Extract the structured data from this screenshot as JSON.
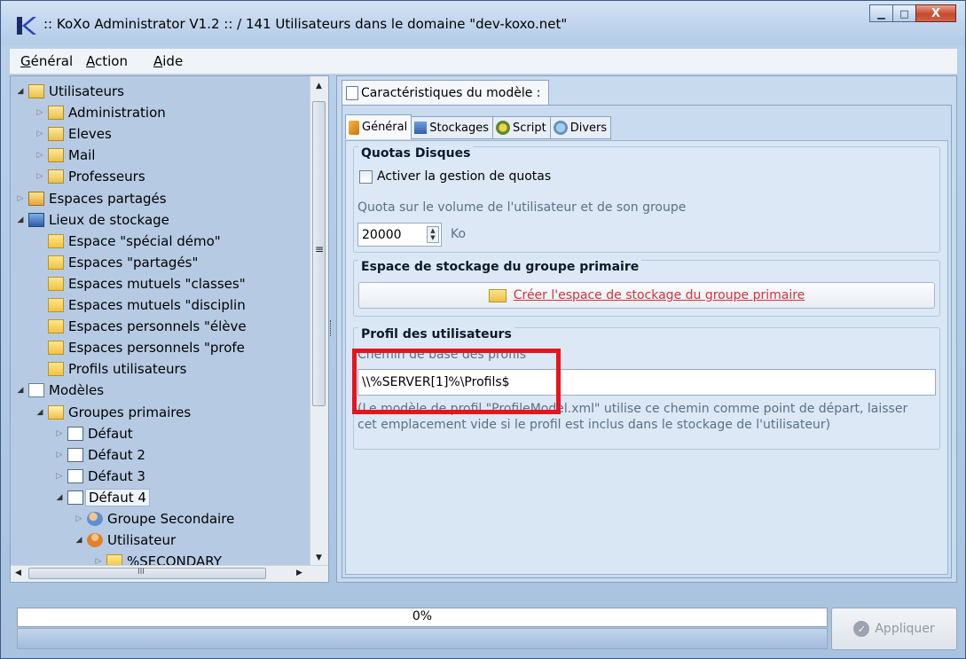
{
  "window": {
    "title": ":: KoXo Administrator V1.2 :: / 141 Utilisateurs dans le domaine \"dev-koxo.net\"",
    "minimize_glyph": "▁",
    "maximize_glyph": "□",
    "close_glyph": "X"
  },
  "menu": {
    "items": [
      "Général",
      "Action",
      "Aide"
    ]
  },
  "tree": {
    "items": [
      {
        "label": "Utilisateurs",
        "level": 0,
        "icon": "folder-users-icon",
        "state": "open"
      },
      {
        "label": "Administration",
        "level": 1,
        "icon": "folder-group-icon",
        "state": "closed"
      },
      {
        "label": "Eleves",
        "level": 1,
        "icon": "folder-group-icon",
        "state": "closed"
      },
      {
        "label": "Mail",
        "level": 1,
        "icon": "folder-group-icon",
        "state": "closed"
      },
      {
        "label": "Professeurs",
        "level": 1,
        "icon": "folder-group-icon",
        "state": "closed"
      },
      {
        "label": "Espaces partagés",
        "level": 0,
        "icon": "shared-spaces-icon",
        "state": "closed"
      },
      {
        "label": "Lieux de stockage",
        "level": 0,
        "icon": "storage-icon",
        "state": "open"
      },
      {
        "label": "Espace \"spécial démo\"",
        "level": 1,
        "icon": "folder-icon",
        "state": "leaf"
      },
      {
        "label": "Espaces \"partagés\"",
        "level": 1,
        "icon": "folder-icon",
        "state": "leaf"
      },
      {
        "label": "Espaces mutuels \"classes\"",
        "level": 1,
        "icon": "folder-icon",
        "state": "leaf"
      },
      {
        "label": "Espaces mutuels \"disciplin",
        "level": 1,
        "icon": "folder-icon",
        "state": "leaf"
      },
      {
        "label": "Espaces personnels \"élève",
        "level": 1,
        "icon": "folder-icon",
        "state": "leaf"
      },
      {
        "label": "Espaces personnels \"profe",
        "level": 1,
        "icon": "folder-icon",
        "state": "leaf"
      },
      {
        "label": "Profils utilisateurs",
        "level": 1,
        "icon": "folder-icon",
        "state": "leaf"
      },
      {
        "label": "Modèles",
        "level": 0,
        "icon": "models-icon",
        "state": "open"
      },
      {
        "label": "Groupes primaires",
        "level": 1,
        "icon": "folder-open-icon",
        "state": "open"
      },
      {
        "label": "Défaut",
        "level": 2,
        "icon": "model-doc-icon",
        "state": "closed"
      },
      {
        "label": "Défaut 2",
        "level": 2,
        "icon": "model-doc-icon",
        "state": "closed"
      },
      {
        "label": "Défaut 3",
        "level": 2,
        "icon": "model-doc-icon",
        "state": "closed"
      },
      {
        "label": "Défaut 4",
        "level": 2,
        "icon": "model-doc-icon",
        "state": "open",
        "selected": true
      },
      {
        "label": "Groupe Secondaire",
        "level": 3,
        "icon": "group-secondary-icon",
        "state": "closed"
      },
      {
        "label": "Utilisateur",
        "level": 3,
        "icon": "user-icon",
        "state": "open"
      },
      {
        "label": "%SECONDARY_",
        "level": 4,
        "icon": "folder-icon",
        "state": "closed"
      }
    ],
    "hscroll_glyph": "III"
  },
  "panel": {
    "outer_tab": "Caractéristiques du modèle :",
    "tabs": [
      {
        "label": "Général",
        "icon": "general-icon",
        "active": true
      },
      {
        "label": "Stockages",
        "icon": "storage-icon",
        "active": false
      },
      {
        "label": "Script",
        "icon": "script-icon",
        "active": false
      },
      {
        "label": "Divers",
        "icon": "misc-icon",
        "active": false
      }
    ],
    "quotas": {
      "title": "Quotas Disques",
      "checkbox_label": "Activer la gestion de quotas",
      "checkbox_checked": false,
      "volume_label": "Quota sur le volume de l'utilisateur et de son groupe",
      "quota_value": "20000",
      "quota_unit": "Ko"
    },
    "primary_storage": {
      "title": "Espace de stockage du groupe primaire",
      "button_label": "Créer l'espace de stockage du groupe primaire"
    },
    "profiles": {
      "title": "Profil des utilisateurs",
      "path_label": "Chemin de base des profils",
      "path_value": "\\\\%SERVER[1]%\\Profils$",
      "note": "(Le modèle de profil \"ProfileModel.xml\" utilise ce chemin comme point de départ, laisser cet emplacement vide si le profil est inclus dans le stockage de l'utilisateur)"
    }
  },
  "footer": {
    "progress_text": "0%",
    "progress_value": 0,
    "apply_label": "Appliquer"
  },
  "colors": {
    "highlight": "#e8141c",
    "link_red": "#d0343a"
  }
}
